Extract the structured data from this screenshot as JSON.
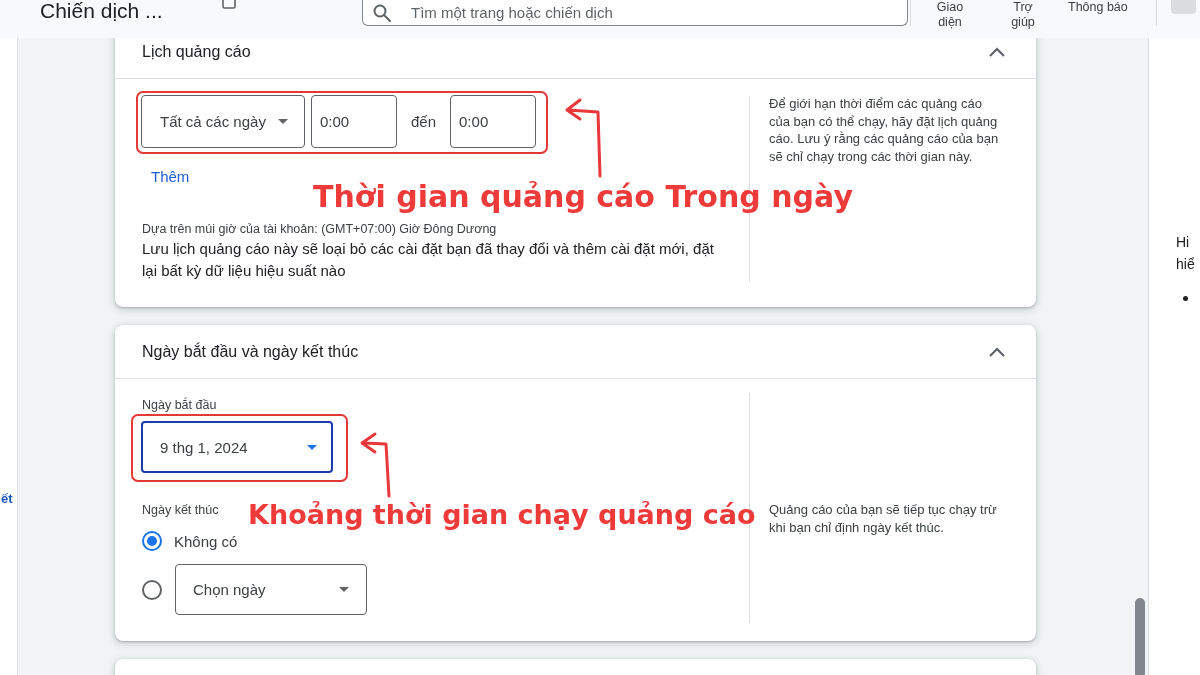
{
  "top_bar": {
    "title": "Chiến dịch ...",
    "search": {
      "placeholder": "Tìm một trang hoặc chiến dịch"
    },
    "actions": [
      {
        "label": "Giao diện"
      },
      {
        "label": "Trợ giúp"
      },
      {
        "label": "Thông báo"
      }
    ]
  },
  "left_nav": {
    "fragment": "ết"
  },
  "ad_schedule": {
    "title": "Lịch quảng cáo",
    "expanded": true,
    "day_select": "Tất cả các ngày",
    "start_time": "0:00",
    "separator": "đến",
    "end_time": "0:00",
    "add_link": "Thêm",
    "timezone_note": "Dựa trên múi giờ của tài khoản: (GMT+07:00) Giờ Đông Dương",
    "warning": "Lưu lịch quảng cáo này sẽ loại bỏ các cài đặt bạn đã thay đổi và thêm cài đặt mới, đặt lại bất kỳ dữ liệu hiệu suất nào",
    "help": "Để giới hạn thời điểm các quảng cáo của bạn có thể chạy, hãy đặt lịch quảng cáo. Lưu ý rằng các quảng cáo của bạn sẽ chỉ chạy trong các thời gian này.",
    "annotation": "Thời gian quảng cáo Trong ngày"
  },
  "dates": {
    "title": "Ngày bắt đầu và ngày kết thúc",
    "expanded": true,
    "start_label": "Ngày bắt đầu",
    "start_date": {
      "value": "9 thg 1, 2024",
      "focused": true
    },
    "end_label": "Ngày kết thúc",
    "end_options": [
      {
        "kind": "text",
        "label": "Không có",
        "selected": true
      },
      {
        "kind": "dropdown",
        "label": "Chọn ngày",
        "selected": false
      }
    ],
    "help": "Quảng cáo của bạn sẽ tiếp tục chạy trừ khi bạn chỉ định ngày kết thúc.",
    "annotation": "Khoảng thời gian chạy quảng cáo"
  },
  "right_panel": {
    "lines": [
      "Hi",
      "hiể"
    ]
  }
}
